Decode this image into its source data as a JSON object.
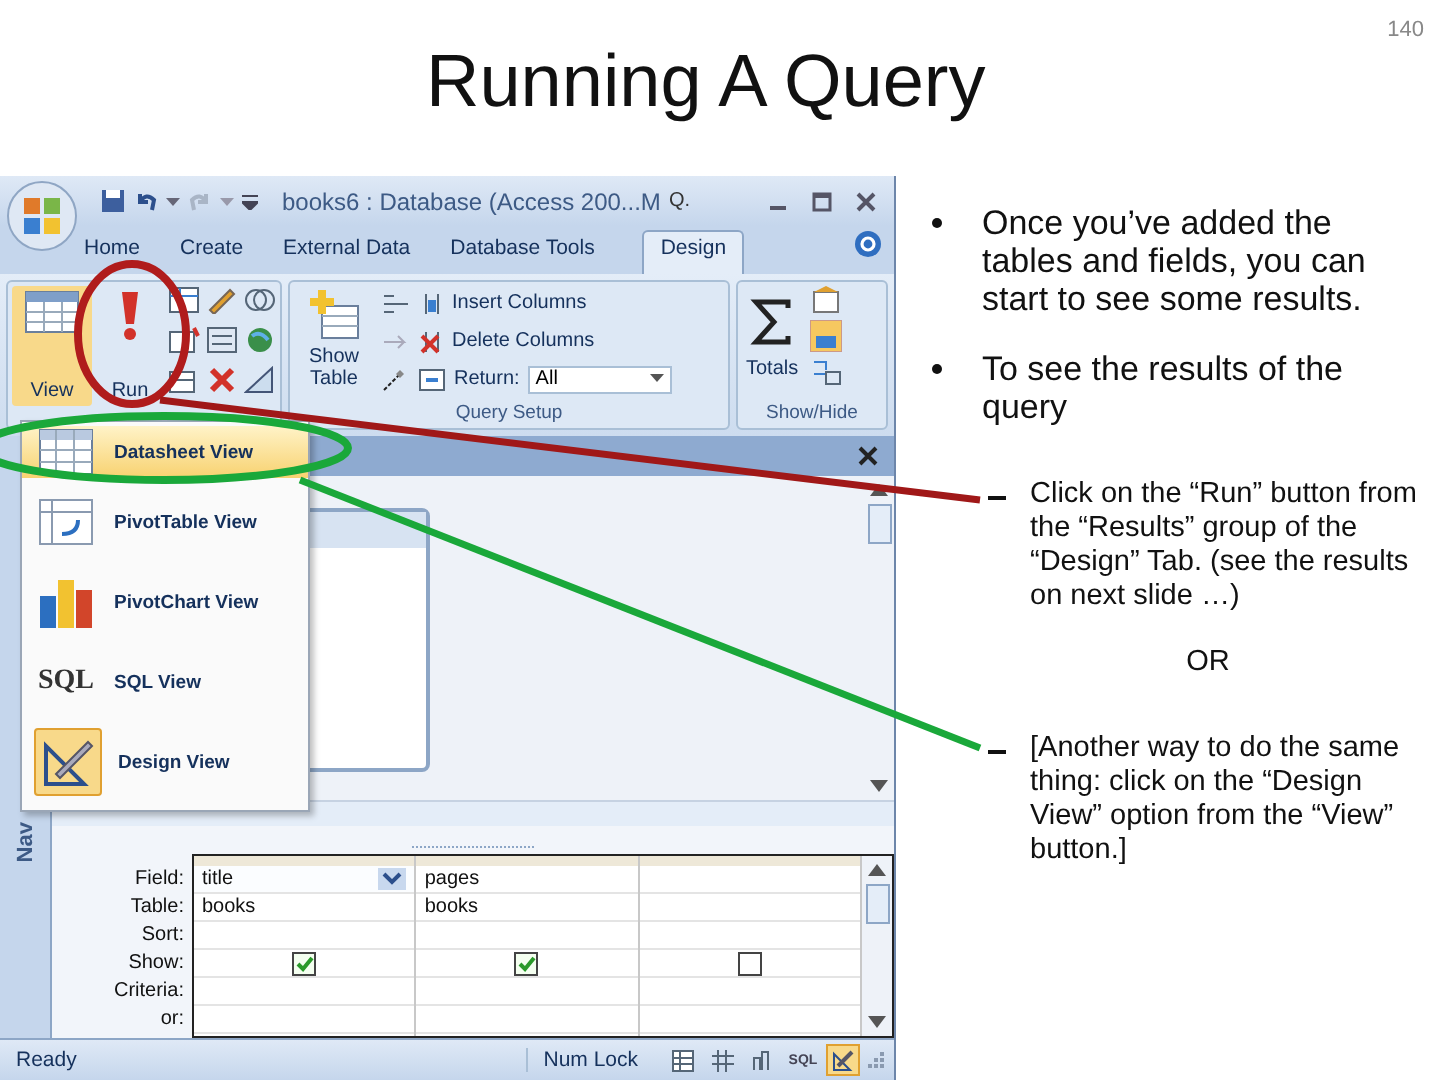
{
  "slide": {
    "title": "Running A Query",
    "page_number": "140"
  },
  "window": {
    "title": "books6 : Database (Access 200...M",
    "title_fragment": "Q."
  },
  "ribbon_tabs": [
    {
      "label": "Home",
      "selected": false
    },
    {
      "label": "Create",
      "selected": false
    },
    {
      "label": "External Data",
      "selected": false
    },
    {
      "label": "Database Tools",
      "selected": false
    },
    {
      "label": "Design",
      "selected": true
    }
  ],
  "ribbon": {
    "view_button": "View",
    "run_button": "Run",
    "show_table_button": "Show Table",
    "insert_columns": "Insert Columns",
    "delete_columns": "Delete Columns",
    "return_label": "Return:",
    "return_value": "All",
    "query_setup_label": "Query Setup",
    "totals_button": "Totals",
    "show_hide_label": "Show/Hide"
  },
  "view_menu": [
    {
      "kind": "datasheet",
      "label": "Datasheet View",
      "selected": true,
      "current": false
    },
    {
      "kind": "pivottable",
      "label": "PivotTable View",
      "selected": false,
      "current": false
    },
    {
      "kind": "pivotchart",
      "label": "PivotChart View",
      "selected": false,
      "current": false
    },
    {
      "kind": "sql",
      "label": "SQL View",
      "icon_text": "SQL",
      "selected": false,
      "current": false
    },
    {
      "kind": "design",
      "label": "Design View",
      "selected": false,
      "current": true
    }
  ],
  "navigation_pane": {
    "label": "Nav"
  },
  "query_grid": {
    "row_labels": [
      "Field:",
      "Table:",
      "Sort:",
      "Show:",
      "Criteria:",
      "or:"
    ],
    "columns": [
      {
        "field": "title",
        "table": "books",
        "show": true,
        "selected": true
      },
      {
        "field": "pages",
        "table": "books",
        "show": true,
        "selected": false
      },
      {
        "show": false,
        "selected": false
      }
    ]
  },
  "status_bar": {
    "status": "Ready",
    "num_lock": "Num Lock",
    "view_buttons": [
      {
        "kind": "datasheet",
        "selected": false
      },
      {
        "kind": "pivottable",
        "selected": false
      },
      {
        "kind": "pivotchart",
        "selected": false
      },
      {
        "kind": "sql",
        "label": "SQL",
        "selected": false
      },
      {
        "kind": "design",
        "selected": true
      }
    ]
  },
  "notes": [
    {
      "text": "Once you’ve added the tables and fields, you can start to see some results."
    },
    {
      "text": "To see the results of the query",
      "children": [
        {
          "kind": "dash",
          "text": "Click on the “Run” button from the “Results” group of the “Design” Tab. (see the results on next slide …)"
        },
        {
          "kind": "plain",
          "text": "OR"
        },
        {
          "kind": "dash",
          "text": "[Another way to do the same thing: click on the “Design View” option from the “View” button.]"
        }
      ]
    }
  ]
}
